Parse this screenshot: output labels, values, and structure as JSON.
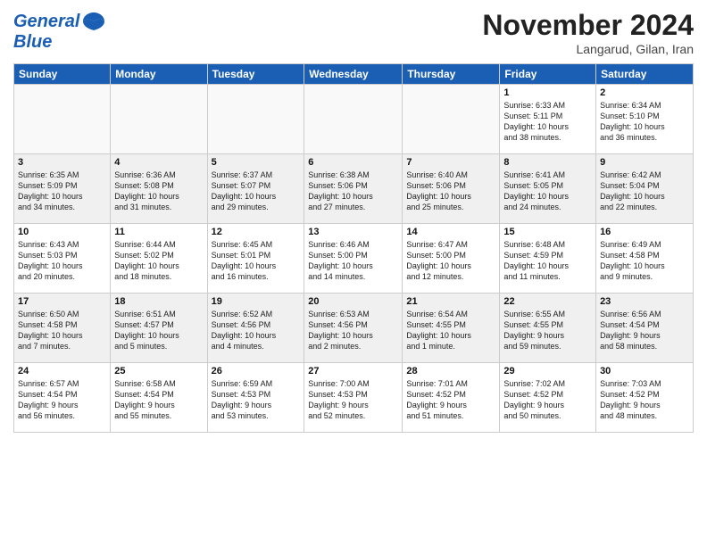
{
  "header": {
    "logo_line1": "General",
    "logo_line2": "Blue",
    "month": "November 2024",
    "location": "Langarud, Gilan, Iran"
  },
  "weekdays": [
    "Sunday",
    "Monday",
    "Tuesday",
    "Wednesday",
    "Thursday",
    "Friday",
    "Saturday"
  ],
  "weeks": [
    {
      "row_class": "row-even",
      "days": [
        {
          "num": "",
          "info": "",
          "empty": true
        },
        {
          "num": "",
          "info": "",
          "empty": true
        },
        {
          "num": "",
          "info": "",
          "empty": true
        },
        {
          "num": "",
          "info": "",
          "empty": true
        },
        {
          "num": "",
          "info": "",
          "empty": true
        },
        {
          "num": "1",
          "info": "Sunrise: 6:33 AM\nSunset: 5:11 PM\nDaylight: 10 hours\nand 38 minutes."
        },
        {
          "num": "2",
          "info": "Sunrise: 6:34 AM\nSunset: 5:10 PM\nDaylight: 10 hours\nand 36 minutes."
        }
      ]
    },
    {
      "row_class": "row-odd",
      "days": [
        {
          "num": "3",
          "info": "Sunrise: 6:35 AM\nSunset: 5:09 PM\nDaylight: 10 hours\nand 34 minutes."
        },
        {
          "num": "4",
          "info": "Sunrise: 6:36 AM\nSunset: 5:08 PM\nDaylight: 10 hours\nand 31 minutes."
        },
        {
          "num": "5",
          "info": "Sunrise: 6:37 AM\nSunset: 5:07 PM\nDaylight: 10 hours\nand 29 minutes."
        },
        {
          "num": "6",
          "info": "Sunrise: 6:38 AM\nSunset: 5:06 PM\nDaylight: 10 hours\nand 27 minutes."
        },
        {
          "num": "7",
          "info": "Sunrise: 6:40 AM\nSunset: 5:06 PM\nDaylight: 10 hours\nand 25 minutes."
        },
        {
          "num": "8",
          "info": "Sunrise: 6:41 AM\nSunset: 5:05 PM\nDaylight: 10 hours\nand 24 minutes."
        },
        {
          "num": "9",
          "info": "Sunrise: 6:42 AM\nSunset: 5:04 PM\nDaylight: 10 hours\nand 22 minutes."
        }
      ]
    },
    {
      "row_class": "row-even",
      "days": [
        {
          "num": "10",
          "info": "Sunrise: 6:43 AM\nSunset: 5:03 PM\nDaylight: 10 hours\nand 20 minutes."
        },
        {
          "num": "11",
          "info": "Sunrise: 6:44 AM\nSunset: 5:02 PM\nDaylight: 10 hours\nand 18 minutes."
        },
        {
          "num": "12",
          "info": "Sunrise: 6:45 AM\nSunset: 5:01 PM\nDaylight: 10 hours\nand 16 minutes."
        },
        {
          "num": "13",
          "info": "Sunrise: 6:46 AM\nSunset: 5:00 PM\nDaylight: 10 hours\nand 14 minutes."
        },
        {
          "num": "14",
          "info": "Sunrise: 6:47 AM\nSunset: 5:00 PM\nDaylight: 10 hours\nand 12 minutes."
        },
        {
          "num": "15",
          "info": "Sunrise: 6:48 AM\nSunset: 4:59 PM\nDaylight: 10 hours\nand 11 minutes."
        },
        {
          "num": "16",
          "info": "Sunrise: 6:49 AM\nSunset: 4:58 PM\nDaylight: 10 hours\nand 9 minutes."
        }
      ]
    },
    {
      "row_class": "row-odd",
      "days": [
        {
          "num": "17",
          "info": "Sunrise: 6:50 AM\nSunset: 4:58 PM\nDaylight: 10 hours\nand 7 minutes."
        },
        {
          "num": "18",
          "info": "Sunrise: 6:51 AM\nSunset: 4:57 PM\nDaylight: 10 hours\nand 5 minutes."
        },
        {
          "num": "19",
          "info": "Sunrise: 6:52 AM\nSunset: 4:56 PM\nDaylight: 10 hours\nand 4 minutes."
        },
        {
          "num": "20",
          "info": "Sunrise: 6:53 AM\nSunset: 4:56 PM\nDaylight: 10 hours\nand 2 minutes."
        },
        {
          "num": "21",
          "info": "Sunrise: 6:54 AM\nSunset: 4:55 PM\nDaylight: 10 hours\nand 1 minute."
        },
        {
          "num": "22",
          "info": "Sunrise: 6:55 AM\nSunset: 4:55 PM\nDaylight: 9 hours\nand 59 minutes."
        },
        {
          "num": "23",
          "info": "Sunrise: 6:56 AM\nSunset: 4:54 PM\nDaylight: 9 hours\nand 58 minutes."
        }
      ]
    },
    {
      "row_class": "row-even",
      "days": [
        {
          "num": "24",
          "info": "Sunrise: 6:57 AM\nSunset: 4:54 PM\nDaylight: 9 hours\nand 56 minutes."
        },
        {
          "num": "25",
          "info": "Sunrise: 6:58 AM\nSunset: 4:54 PM\nDaylight: 9 hours\nand 55 minutes."
        },
        {
          "num": "26",
          "info": "Sunrise: 6:59 AM\nSunset: 4:53 PM\nDaylight: 9 hours\nand 53 minutes."
        },
        {
          "num": "27",
          "info": "Sunrise: 7:00 AM\nSunset: 4:53 PM\nDaylight: 9 hours\nand 52 minutes."
        },
        {
          "num": "28",
          "info": "Sunrise: 7:01 AM\nSunset: 4:52 PM\nDaylight: 9 hours\nand 51 minutes."
        },
        {
          "num": "29",
          "info": "Sunrise: 7:02 AM\nSunset: 4:52 PM\nDaylight: 9 hours\nand 50 minutes."
        },
        {
          "num": "30",
          "info": "Sunrise: 7:03 AM\nSunset: 4:52 PM\nDaylight: 9 hours\nand 48 minutes."
        }
      ]
    }
  ]
}
